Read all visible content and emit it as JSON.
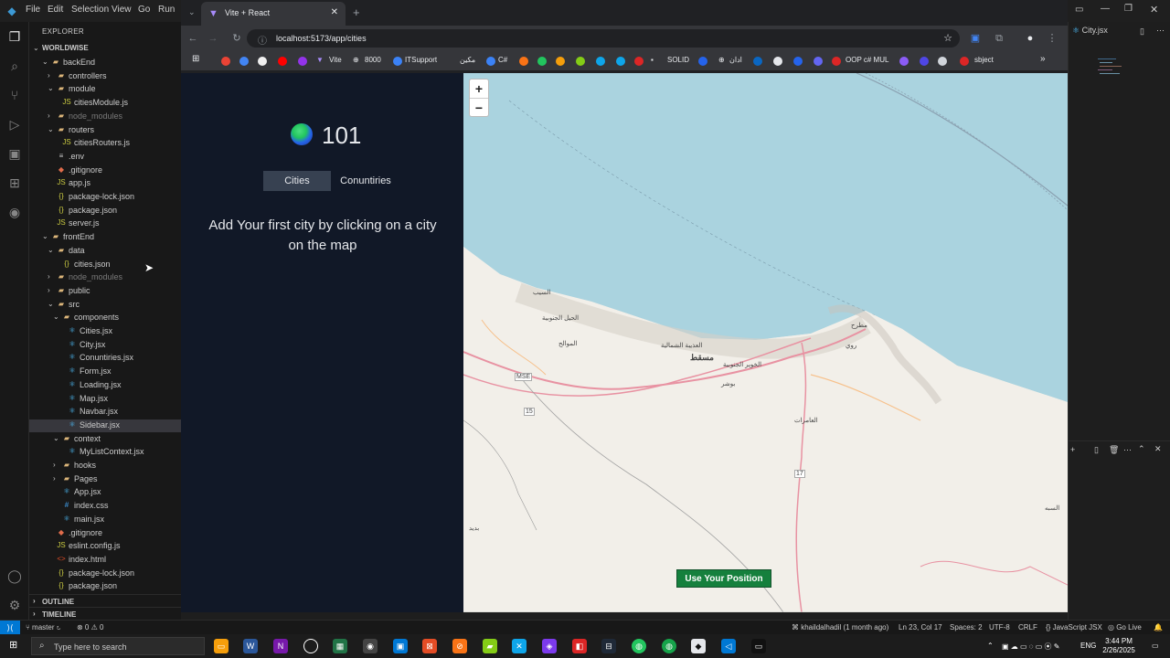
{
  "vscode": {
    "menu": [
      "File",
      "Edit",
      "Selection",
      "View",
      "Go",
      "Run"
    ],
    "explorer_title": "EXPLORER",
    "workspace": "WORLDWISE",
    "tree": [
      {
        "label": "backEnd",
        "kind": "folder",
        "depth": 1,
        "open": true
      },
      {
        "label": "controllers",
        "kind": "folder",
        "depth": 2,
        "open": false
      },
      {
        "label": "module",
        "kind": "folder",
        "depth": 2,
        "open": true
      },
      {
        "label": "citiesModule.js",
        "kind": "js",
        "depth": 3
      },
      {
        "label": "node_modules",
        "kind": "folder",
        "depth": 2,
        "open": false,
        "dim": true
      },
      {
        "label": "routers",
        "kind": "folder",
        "depth": 2,
        "open": true
      },
      {
        "label": "citiesRouters.js",
        "kind": "js",
        "depth": 3
      },
      {
        "label": ".env",
        "kind": "env",
        "depth": 2
      },
      {
        "label": ".gitignore",
        "kind": "git",
        "depth": 2
      },
      {
        "label": "app.js",
        "kind": "js",
        "depth": 2
      },
      {
        "label": "package-lock.json",
        "kind": "json",
        "depth": 2
      },
      {
        "label": "package.json",
        "kind": "json",
        "depth": 2
      },
      {
        "label": "server.js",
        "kind": "js",
        "depth": 2
      },
      {
        "label": "frontEnd",
        "kind": "folder",
        "depth": 1,
        "open": true
      },
      {
        "label": "data",
        "kind": "folder",
        "depth": 2,
        "open": true
      },
      {
        "label": "cities.json",
        "kind": "json",
        "depth": 3
      },
      {
        "label": "node_modules",
        "kind": "folder",
        "depth": 2,
        "open": false,
        "dim": true
      },
      {
        "label": "public",
        "kind": "folder",
        "depth": 2,
        "open": false
      },
      {
        "label": "src",
        "kind": "folder",
        "depth": 2,
        "open": true
      },
      {
        "label": "components",
        "kind": "folder",
        "depth": 3,
        "open": true
      },
      {
        "label": "Cities.jsx",
        "kind": "jsx",
        "depth": 4
      },
      {
        "label": "City.jsx",
        "kind": "jsx",
        "depth": 4
      },
      {
        "label": "Conuntiries.jsx",
        "kind": "jsx",
        "depth": 4
      },
      {
        "label": "Form.jsx",
        "kind": "jsx",
        "depth": 4
      },
      {
        "label": "Loading.jsx",
        "kind": "jsx",
        "depth": 4
      },
      {
        "label": "Map.jsx",
        "kind": "jsx",
        "depth": 4
      },
      {
        "label": "Navbar.jsx",
        "kind": "jsx",
        "depth": 4
      },
      {
        "label": "Sidebar.jsx",
        "kind": "jsx",
        "depth": 4,
        "selected": true
      },
      {
        "label": "context",
        "kind": "folder",
        "depth": 3,
        "open": true
      },
      {
        "label": "MyListContext.jsx",
        "kind": "jsx",
        "depth": 4
      },
      {
        "label": "hooks",
        "kind": "folder",
        "depth": 3,
        "open": false
      },
      {
        "label": "Pages",
        "kind": "folder",
        "depth": 3,
        "open": false
      },
      {
        "label": "App.jsx",
        "kind": "jsx",
        "depth": 3
      },
      {
        "label": "index.css",
        "kind": "css",
        "depth": 3
      },
      {
        "label": "main.jsx",
        "kind": "jsx",
        "depth": 3
      },
      {
        "label": ".gitignore",
        "kind": "git",
        "depth": 2
      },
      {
        "label": "eslint.config.js",
        "kind": "js",
        "depth": 2
      },
      {
        "label": "index.html",
        "kind": "html",
        "depth": 2
      },
      {
        "label": "package-lock.json",
        "kind": "json",
        "depth": 2
      },
      {
        "label": "package.json",
        "kind": "json",
        "depth": 2
      }
    ],
    "outline_label": "OUTLINE",
    "timeline_label": "TIMELINE",
    "right_tab": "City.jsx"
  },
  "browser": {
    "tab_title": "Vite + React",
    "url": "localhost:5173/app/cities",
    "bookmarks": [
      "Vite",
      "8000",
      "ITSupport",
      "مكين",
      "C#",
      "SOLID",
      "ادان",
      "OOP c# MUL",
      "sbject"
    ]
  },
  "app": {
    "logo_number": "101",
    "nav_cities": "Cities",
    "nav_countries": "Conuntiries",
    "empty_message": "Add Your first city by clicking on a city on the map",
    "use_position": "Use Your Position",
    "zoom_in": "+",
    "zoom_out": "−"
  },
  "map_labels": {
    "seeb": "السيب",
    "muscat": "مسقط",
    "muttrah": "مطرح",
    "bausher": "بوشر",
    "amerat": "العامرات",
    "mawaleh": "الموالح",
    "north_azaiba": "العذيبة الشمالية",
    "south_khuwair": "الخوير الجنوبية",
    "south_hail": "الحيل الجنوبية",
    "ruwi": "روي",
    "seeb_south": "السبه",
    "badid": "بديد",
    "mse": "MSE",
    "r15": "15",
    "r17": "17"
  },
  "statusbar": {
    "branch": "master",
    "problems": "⊗ 0 ⚠ 0",
    "git_blame": "khaildalhadil (1 month ago)",
    "cursor": "Ln 23, Col 17",
    "spaces": "Spaces: 2",
    "encoding": "UTF-8",
    "eol": "CRLF",
    "language": "JavaScript JSX",
    "golive": "Go Live"
  },
  "taskbar": {
    "search_placeholder": "Type here to search",
    "lang": "ENG",
    "time": "3:44 PM",
    "date": "2/26/2025"
  }
}
